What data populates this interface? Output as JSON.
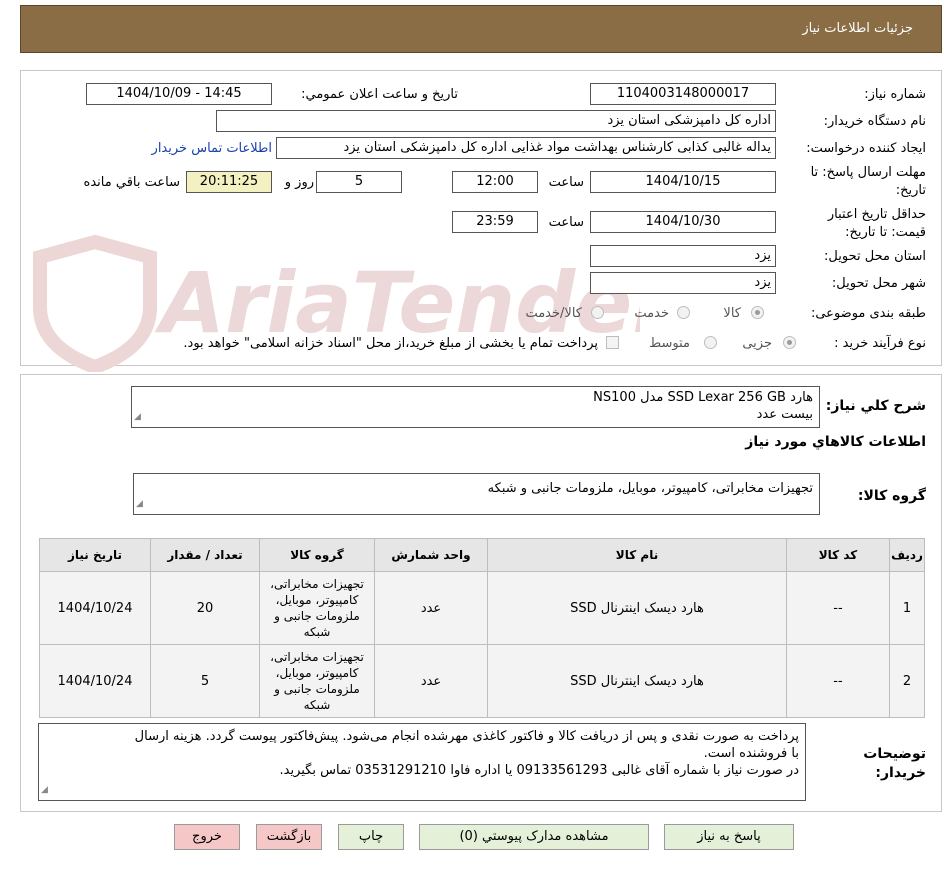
{
  "header": {
    "title": "جزئیات اطلاعات نیاز"
  },
  "watermark": {
    "text": "AriaTender.neT",
    "color": "#e8d0d0"
  },
  "fields": {
    "need_number_label": "شماره نیاز:",
    "need_number": "1104003148000017",
    "announce_label": "تاريخ و ساعت اعلان عمومي:",
    "announce_value": "1404/10/09 - 14:45",
    "buyer_org_label": "نام دستگاه خریدار:",
    "buyer_org": "اداره کل دامپزشکی استان یزد",
    "creator_label": "ایجاد کننده درخواست:",
    "creator": "یداله غالبی کذابی کارشناس بهداشت مواد غذایی اداره کل دامپزشکی استان یزد",
    "contact_link": "اطلاعات تماس خریدار",
    "deadline_label_1": "مهلت ارسال پاسخ: تا",
    "deadline_label_2": "تاریخ:",
    "deadline_date": "1404/10/15",
    "time_label": "ساعت",
    "deadline_time": "12:00",
    "days_value": "5",
    "days_label": "روز و",
    "remaining_time": "20:11:25",
    "remaining_label": "ساعت باقي مانده",
    "validity_label_1": "حداقل تاریخ اعتبار",
    "validity_label_2": "قیمت: تا تاریخ:",
    "validity_date": "1404/10/30",
    "validity_time": "23:59",
    "province_label": "استان محل تحویل:",
    "province": "یزد",
    "city_label": "شهر محل تحویل:",
    "city": "یزد",
    "category_label": "طبقه بندی موضوعی:",
    "category_options": [
      "کالا",
      "خدمت",
      "کالا/خدمت"
    ],
    "process_label": "نوع فرآیند خرید :",
    "process_options": [
      "جزیی",
      "متوسط"
    ],
    "payment_note": "پرداخت تمام یا بخشی از مبلغ خرید،از محل \"اسناد خزانه اسلامی\" خواهد بود."
  },
  "summary": {
    "label": "شرح کلي نياز:",
    "line1": "هارد SSD Lexar 256 GB مدل NS100",
    "line2": "بیست عدد"
  },
  "goods_info": {
    "title": "اطلاعات کالاهاي مورد نياز",
    "group_label": "گروه کالا:",
    "group_value": "تجهیزات مخابراتی، کامپیوتر، موبایل، ملزومات جانبی و شبکه"
  },
  "table": {
    "headers": [
      "ردیف",
      "کد کالا",
      "نام کالا",
      "واحد شمارش",
      "گروه کالا",
      "تعداد / مقدار",
      "تاریخ نیاز"
    ],
    "rows": [
      {
        "row": "1",
        "code": "--",
        "name": "هارد دیسک اینترنال SSD",
        "unit": "عدد",
        "group": "تجهیزات مخابراتی، کامپیوتر، موبایل، ملزومات جانبی و شبکه",
        "qty": "20",
        "date": "1404/10/24"
      },
      {
        "row": "2",
        "code": "--",
        "name": "هارد دیسک اینترنال SSD",
        "unit": "عدد",
        "group": "تجهیزات مخابراتی، کامپیوتر، موبایل، ملزومات جانبی و شبکه",
        "qty": "5",
        "date": "1404/10/24"
      }
    ]
  },
  "buyer_notes": {
    "label_1": "توضیحات",
    "label_2": "خریدار:",
    "line1": "پرداخت به صورت نقدی و پس از دریافت کالا و فاکتور کاغذی مهرشده انجام می‌شود. پیش‌فاکتور پیوست گردد. هزینه ارسال",
    "line2": "با فروشنده است.",
    "line3": "در صورت نیاز با شماره آقای غالبی 09133561293 یا اداره فاوا 03531291210 تماس بگیرید."
  },
  "buttons": {
    "reply": "پاسخ به نیاز",
    "attachments": "مشاهده مدارک پیوستي (0)",
    "print": "چاپ",
    "back": "بازگشت",
    "exit": "خروج"
  }
}
